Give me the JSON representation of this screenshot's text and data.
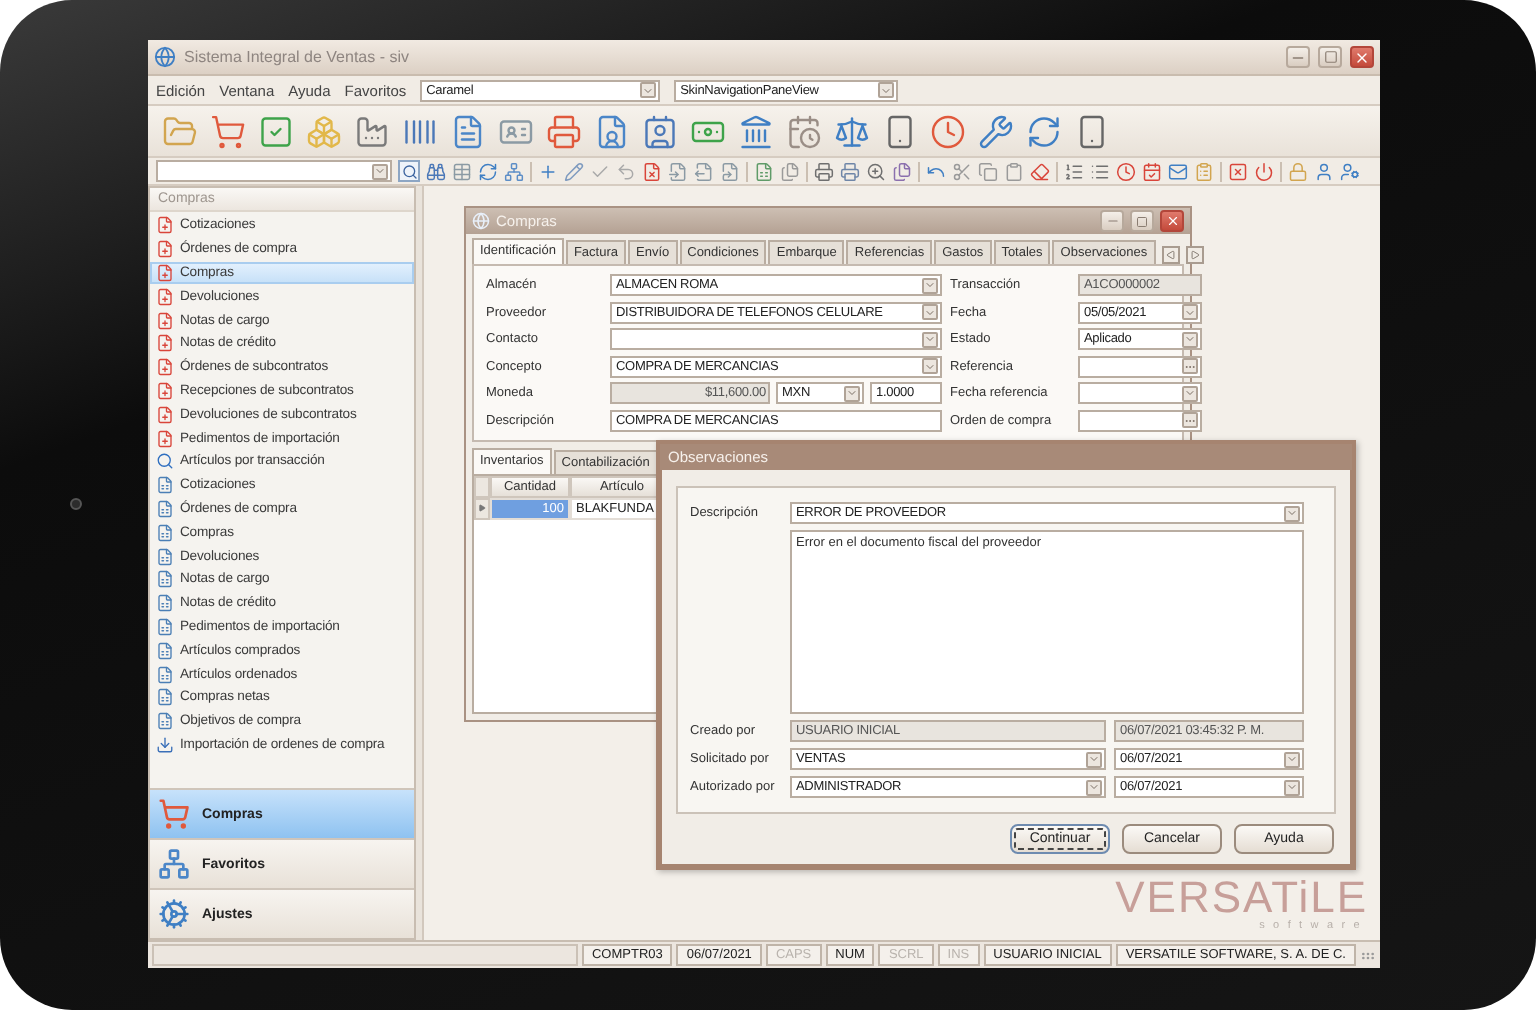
{
  "window": {
    "title": "Sistema Integral de Ventas - siv"
  },
  "menu": [
    "Edición",
    "Ventana",
    "Ayuda",
    "Favoritos"
  ],
  "menu_combos": [
    {
      "value": "Caramel"
    },
    {
      "value": "SkinNavigationPaneView"
    }
  ],
  "sidebar": {
    "title": "Compras",
    "items": [
      {
        "label": "Cotizaciones",
        "kind": "document",
        "selected": false
      },
      {
        "label": "Órdenes de compra",
        "kind": "document",
        "selected": false
      },
      {
        "label": "Compras",
        "kind": "document",
        "selected": true
      },
      {
        "label": "Devoluciones",
        "kind": "document",
        "selected": false
      },
      {
        "label": "Notas de cargo",
        "kind": "document",
        "selected": false
      },
      {
        "label": "Notas de crédito",
        "kind": "document",
        "selected": false
      },
      {
        "label": "Órdenes de subcontratos",
        "kind": "document",
        "selected": false
      },
      {
        "label": "Recepciones de subcontratos",
        "kind": "document",
        "selected": false
      },
      {
        "label": "Devoluciones de subcontratos",
        "kind": "document",
        "selected": false
      },
      {
        "label": "Pedimentos de importación",
        "kind": "document",
        "selected": false
      },
      {
        "label": "Artículos por transacción",
        "kind": "search",
        "selected": false
      },
      {
        "label": "Cotizaciones",
        "kind": "report",
        "selected": false
      },
      {
        "label": "Órdenes de compra",
        "kind": "report",
        "selected": false
      },
      {
        "label": "Compras",
        "kind": "report",
        "selected": false
      },
      {
        "label": "Devoluciones",
        "kind": "report",
        "selected": false
      },
      {
        "label": "Notas de cargo",
        "kind": "report",
        "selected": false
      },
      {
        "label": "Notas de crédito",
        "kind": "report",
        "selected": false
      },
      {
        "label": "Pedimentos de importación",
        "kind": "report",
        "selected": false
      },
      {
        "label": "Artículos comprados",
        "kind": "report",
        "selected": false
      },
      {
        "label": "Artículos ordenados",
        "kind": "report",
        "selected": false
      },
      {
        "label": "Compras netas",
        "kind": "report",
        "selected": false
      },
      {
        "label": "Objetivos de compra",
        "kind": "report",
        "selected": false
      },
      {
        "label": "Importación de ordenes de compra",
        "kind": "import",
        "selected": false
      }
    ],
    "nav": [
      {
        "label": "Compras",
        "kind": "cart",
        "selected": true
      },
      {
        "label": "Favoritos",
        "kind": "tree",
        "selected": false
      },
      {
        "label": "Ajustes",
        "kind": "gears",
        "selected": false
      }
    ]
  },
  "purchase_window": {
    "title": "Compras",
    "tabs": [
      {
        "label": "Identificación",
        "selected": true
      },
      {
        "label": "Factura",
        "selected": false
      },
      {
        "label": "Envío",
        "selected": false
      },
      {
        "label": "Condiciones",
        "selected": false
      },
      {
        "label": "Embarque",
        "selected": false
      },
      {
        "label": "Referencias",
        "selected": false
      },
      {
        "label": "Gastos",
        "selected": false
      },
      {
        "label": "Totales",
        "selected": false
      },
      {
        "label": "Observaciones",
        "selected": false
      }
    ],
    "fields_left": [
      {
        "label": "Almacén",
        "kind": "combo",
        "value": "ALMACEN ROMA",
        "disabled": false
      },
      {
        "label": "Proveedor",
        "kind": "combo",
        "value": "DISTRIBUIDORA DE TELEFONOS CELULARE",
        "disabled": false
      },
      {
        "label": "Contacto",
        "kind": "combo",
        "disabled": false
      },
      {
        "label": "Concepto",
        "kind": "combo",
        "value": "COMPRA DE MERCANCIAS",
        "disabled": false
      },
      {
        "label": "Moneda",
        "kind": "currency",
        "value": "$11,600.00",
        "currency": "MXN",
        "rate": "1.0000",
        "disabled": true
      },
      {
        "label": "Descripción",
        "kind": "text",
        "value": "COMPRA DE MERCANCIAS",
        "disabled": false
      }
    ],
    "fields_right": [
      {
        "label": "Transacción",
        "kind": "text",
        "value": "A1CO000002",
        "disabled": true
      },
      {
        "label": "Fecha",
        "kind": "combo",
        "value": "05/05/2021",
        "disabled": false
      },
      {
        "label": "Estado",
        "kind": "combo",
        "value": "Aplicado",
        "disabled": false
      },
      {
        "label": "Referencia",
        "kind": "ellipsis",
        "disabled": false
      },
      {
        "label": "Fecha referencia",
        "kind": "combo",
        "disabled": false
      },
      {
        "label": "Orden de compra",
        "kind": "ellipsis",
        "disabled": false
      }
    ],
    "lower_tabs": [
      {
        "label": "Inventarios",
        "selected": true
      },
      {
        "label": "Contabilización",
        "selected": false
      }
    ],
    "grid": {
      "columns": [
        "Cantidad",
        "Artículo"
      ],
      "rows": [
        {
          "cells": [
            {
              "text": "100",
              "selected": true
            },
            {
              "text": "BLAKFUNDA",
              "selected": false
            }
          ]
        }
      ]
    }
  },
  "dialog": {
    "title": "Observaciones",
    "description": {
      "label": "Descripción",
      "value": "ERROR DE PROVEEDOR"
    },
    "notes": "Error en el documento fiscal del proveedor",
    "rows": [
      {
        "label": "Creado por",
        "user": "USUARIO INICIAL",
        "date": "06/07/2021 03:45:32 P. M.",
        "disabled": true
      },
      {
        "label": "Solicitado por",
        "user": "VENTAS",
        "date": "06/07/2021",
        "disabled": false
      },
      {
        "label": "Autorizado por",
        "user": "ADMINISTRADOR",
        "date": "06/07/2021",
        "disabled": false
      }
    ],
    "buttons": [
      {
        "label": "Continuar",
        "focused": true
      },
      {
        "label": "Cancelar",
        "focused": false
      },
      {
        "label": "Ayuda",
        "focused": false
      }
    ]
  },
  "logo": {
    "name": "VERSATiLE",
    "tagline": "software"
  },
  "status_bar": [
    {
      "text": "COMPTR03",
      "on": true
    },
    {
      "text": "06/07/2021",
      "on": true
    },
    {
      "text": "CAPS",
      "on": false
    },
    {
      "text": "NUM",
      "on": true
    },
    {
      "text": "SCRL",
      "on": false
    },
    {
      "text": "INS",
      "on": false
    },
    {
      "text": "USUARIO INICIAL",
      "on": true
    },
    {
      "text": "VERSATILE SOFTWARE, S. A. DE C.",
      "on": true
    }
  ]
}
